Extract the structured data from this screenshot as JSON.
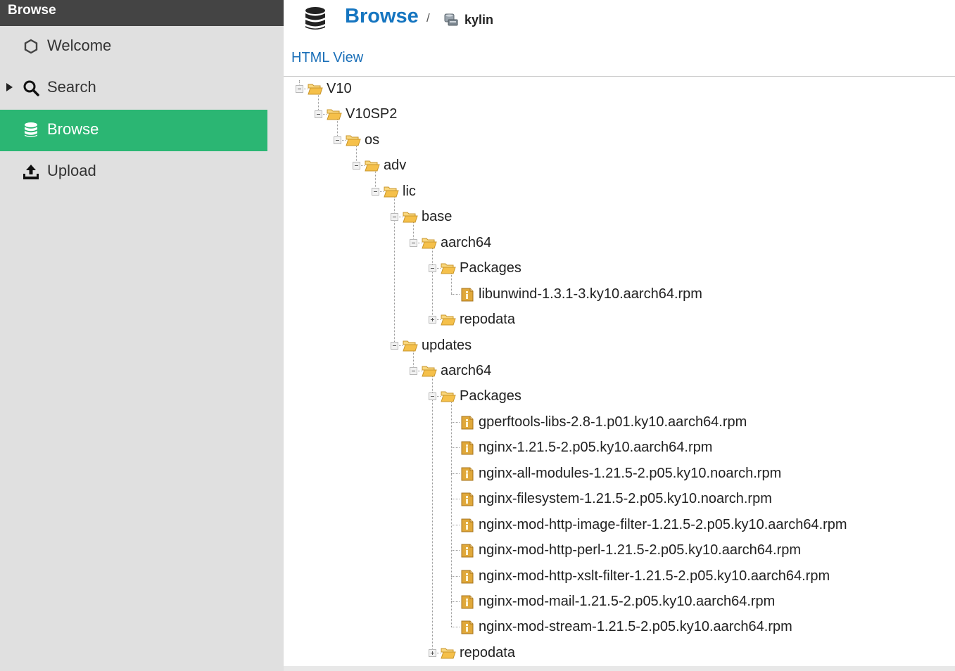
{
  "sidebar": {
    "header": "Browse",
    "items": [
      {
        "label": "Welcome",
        "icon": "hexagon-icon"
      },
      {
        "label": "Search",
        "icon": "search-icon"
      },
      {
        "label": "Browse",
        "icon": "database-icon",
        "active": true
      },
      {
        "label": "Upload",
        "icon": "upload-icon"
      }
    ]
  },
  "breadcrumb": {
    "title": "Browse",
    "separator": "/",
    "repository": "kylin"
  },
  "view_link": "HTML View",
  "tree": [
    {
      "label": "V10",
      "type": "folder",
      "state": "expanded",
      "depth": 0
    },
    {
      "label": "V10SP2",
      "type": "folder",
      "state": "expanded",
      "depth": 1
    },
    {
      "label": "os",
      "type": "folder",
      "state": "expanded",
      "depth": 2
    },
    {
      "label": "adv",
      "type": "folder",
      "state": "expanded",
      "depth": 3
    },
    {
      "label": "lic",
      "type": "folder",
      "state": "expanded",
      "depth": 4
    },
    {
      "label": "base",
      "type": "folder",
      "state": "expanded",
      "depth": 5
    },
    {
      "label": "aarch64",
      "type": "folder",
      "state": "expanded",
      "depth": 6
    },
    {
      "label": "Packages",
      "type": "folder",
      "state": "expanded",
      "depth": 7
    },
    {
      "label": "libunwind-1.3.1-3.ky10.aarch64.rpm",
      "type": "file",
      "depth": 8
    },
    {
      "label": "repodata",
      "type": "folder",
      "state": "collapsed",
      "depth": 7
    },
    {
      "label": "updates",
      "type": "folder",
      "state": "expanded",
      "depth": 5
    },
    {
      "label": "aarch64",
      "type": "folder",
      "state": "expanded",
      "depth": 6
    },
    {
      "label": "Packages",
      "type": "folder",
      "state": "expanded",
      "depth": 7
    },
    {
      "label": "gperftools-libs-2.8-1.p01.ky10.aarch64.rpm",
      "type": "file",
      "depth": 8
    },
    {
      "label": "nginx-1.21.5-2.p05.ky10.aarch64.rpm",
      "type": "file",
      "depth": 8
    },
    {
      "label": "nginx-all-modules-1.21.5-2.p05.ky10.noarch.rpm",
      "type": "file",
      "depth": 8
    },
    {
      "label": "nginx-filesystem-1.21.5-2.p05.ky10.noarch.rpm",
      "type": "file",
      "depth": 8
    },
    {
      "label": "nginx-mod-http-image-filter-1.21.5-2.p05.ky10.aarch64.rpm",
      "type": "file",
      "depth": 8
    },
    {
      "label": "nginx-mod-http-perl-1.21.5-2.p05.ky10.aarch64.rpm",
      "type": "file",
      "depth": 8
    },
    {
      "label": "nginx-mod-http-xslt-filter-1.21.5-2.p05.ky10.aarch64.rpm",
      "type": "file",
      "depth": 8
    },
    {
      "label": "nginx-mod-mail-1.21.5-2.p05.ky10.aarch64.rpm",
      "type": "file",
      "depth": 8
    },
    {
      "label": "nginx-mod-stream-1.21.5-2.p05.ky10.aarch64.rpm",
      "type": "file",
      "depth": 8
    },
    {
      "label": "repodata",
      "type": "folder",
      "state": "collapsed",
      "depth": 7
    }
  ],
  "colors": {
    "accent": "#2bb673",
    "link": "#1575c0",
    "sidebar_bg": "#e0e0e0",
    "sidebar_header_bg": "#444444",
    "folder": "#f5c04a",
    "file": "#e0a83a"
  }
}
